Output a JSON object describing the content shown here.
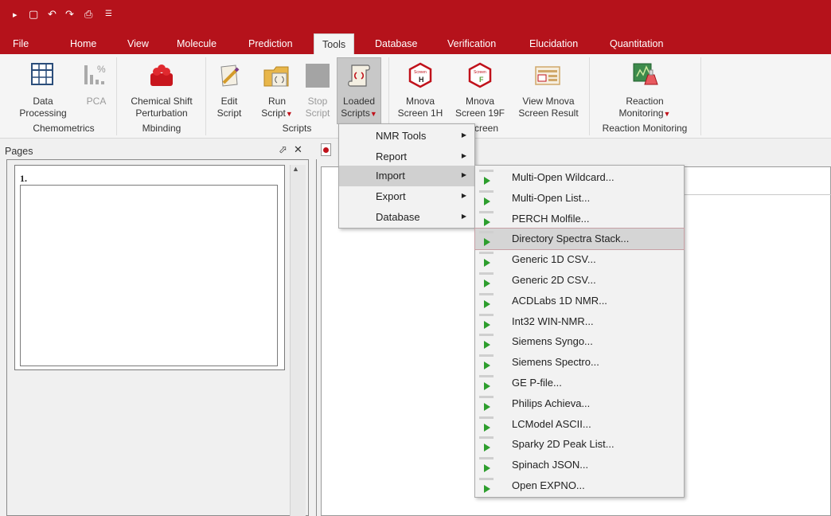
{
  "quick_access": [
    "save-icon",
    "undo-icon",
    "redo-icon",
    "print-icon",
    "customize-icon"
  ],
  "tabs": [
    "File",
    "Home",
    "View",
    "Molecule",
    "Prediction",
    "Tools",
    "Database",
    "Verification",
    "Elucidation",
    "Quantitation"
  ],
  "active_tab": "Tools",
  "ribbon": {
    "data_processing": [
      "Data",
      "Processing"
    ],
    "pca": "PCA",
    "chemometrics": "Chemometrics",
    "chemical_shift": [
      "Chemical Shift",
      "Perturbation"
    ],
    "mbinding": "Mbinding",
    "edit_script": [
      "Edit",
      "Script"
    ],
    "run_script": [
      "Run",
      "Script"
    ],
    "stop_script": [
      "Stop",
      "Script"
    ],
    "loaded_scripts": [
      "Loaded",
      "Scripts"
    ],
    "scripts": "Scripts",
    "mnova_1h": [
      "Mnova",
      "Screen 1H"
    ],
    "mnova_19f": [
      "Mnova",
      "Screen 19F"
    ],
    "screen_group": "creen",
    "view_result": [
      "View Mnova",
      "Screen Result"
    ],
    "reaction_monitoring": [
      "Reaction",
      "Monitoring"
    ],
    "reaction_monitoring_group": "Reaction Monitoring"
  },
  "pages_panel": {
    "title": "Pages",
    "pin": "⬀",
    "close": "✕",
    "page_number": "1."
  },
  "menu": {
    "items": [
      "NMR Tools",
      "Report",
      "Import",
      "Export",
      "Database"
    ],
    "highlighted": "Import"
  },
  "submenu": {
    "items": [
      "Multi-Open Wildcard...",
      "Multi-Open List...",
      "PERCH Molfile...",
      "Directory Spectra Stack...",
      "Generic 1D CSV...",
      "Generic 2D CSV...",
      "ACDLabs 1D NMR...",
      "Int32 WIN-NMR...",
      "Siemens Syngo...",
      "Siemens Spectro...",
      "GE P-file...",
      "Philips Achieva...",
      "LCModel ASCII...",
      "Sparky 2D Peak List...",
      "Spinach JSON...",
      "Open EXPNO..."
    ],
    "highlighted": "Directory Spectra Stack..."
  },
  "colors": {
    "brand": "#b5121b",
    "play": "#2d9e2d"
  }
}
